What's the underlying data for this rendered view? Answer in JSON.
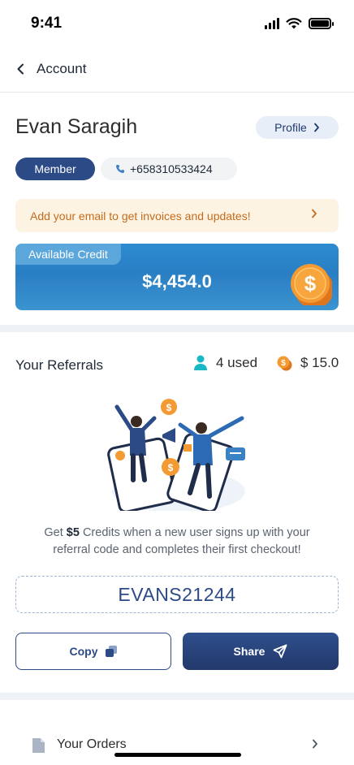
{
  "status": {
    "time": "9:41"
  },
  "header": {
    "title": "Account"
  },
  "user": {
    "name": "Evan Saragih",
    "profile_label": "Profile",
    "member_label": "Member",
    "phone": "+658310533424"
  },
  "email_banner": {
    "text": "Add your email to get invoices and updates!"
  },
  "credit": {
    "label": "Available Credit",
    "amount": "$4,454.0"
  },
  "referrals": {
    "title": "Your Referrals",
    "used": "4 used",
    "earned": "$ 15.0",
    "desc_prefix": "Get ",
    "desc_amount": "$5",
    "desc_suffix": " Credits when a new user signs up with your referral code and completes their first checkout!",
    "code": "EVANS21244",
    "copy_label": "Copy",
    "share_label": "Share"
  },
  "orders": {
    "label": "Your Orders"
  },
  "colors": {
    "primary": "#2c4a86",
    "credit_blue": "#2d8bd0",
    "coin_orange": "#f0892a",
    "banner_bg": "#fdf3e3",
    "banner_text": "#c56b1b",
    "teal": "#18b8c4"
  }
}
